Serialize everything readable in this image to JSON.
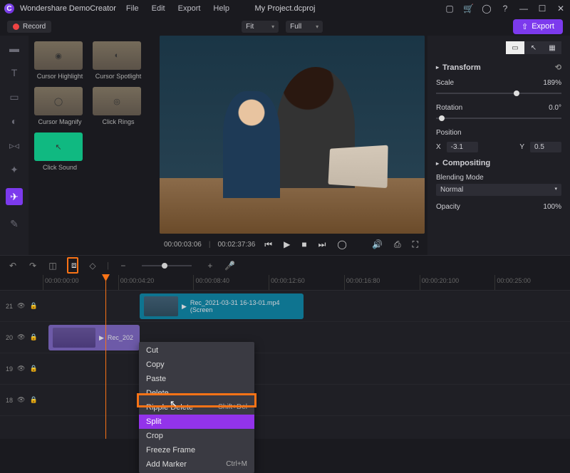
{
  "app": {
    "name": "Wondershare DemoCreator",
    "project": "My Project.dcproj"
  },
  "menu": [
    "File",
    "Edit",
    "Export",
    "Help"
  ],
  "toolbar": {
    "record": "Record",
    "fit": "Fit",
    "full": "Full",
    "export": "Export"
  },
  "library": {
    "items": [
      {
        "label": "Cursor Highlight"
      },
      {
        "label": "Cursor Spotlight"
      },
      {
        "label": "Cursor Magnify"
      },
      {
        "label": "Click Rings"
      },
      {
        "label": "Click Sound"
      }
    ]
  },
  "preview": {
    "current_time": "00:00:03:06",
    "total_time": "00:02:37:36"
  },
  "properties": {
    "transform": "Transform",
    "scale_label": "Scale",
    "scale_value": "189%",
    "rotation_label": "Rotation",
    "rotation_value": "0.0°",
    "position_label": "Position",
    "pos_x_label": "X",
    "pos_x": "-3.1",
    "pos_y_label": "Y",
    "pos_y": "0.5",
    "compositing": "Compositing",
    "blend_label": "Blending Mode",
    "blend_value": "Normal",
    "opacity_label": "Opacity",
    "opacity_value": "100%"
  },
  "ruler": [
    "00:00:00:00",
    "00:00:04:20",
    "00:00:08:40",
    "00:00:12:60",
    "00:00:16:80",
    "00:00:20:100",
    "00:00:25:00"
  ],
  "tracks": {
    "t21": "21",
    "t20": "20",
    "t19": "19",
    "t18": "18",
    "clip1": "Rec_2021-03-31 16-13-01.mp4 (Screen",
    "clip2": "Rec_202"
  },
  "context_menu": {
    "cut": "Cut",
    "copy": "Copy",
    "paste": "Paste",
    "delete": "Delete",
    "ripple_delete": "Ripple Delete",
    "ripple_delete_sc": "Shift+Del",
    "split": "Split",
    "crop": "Crop",
    "freeze": "Freeze Frame",
    "marker": "Add Marker",
    "marker_sc": "Ctrl+M"
  }
}
